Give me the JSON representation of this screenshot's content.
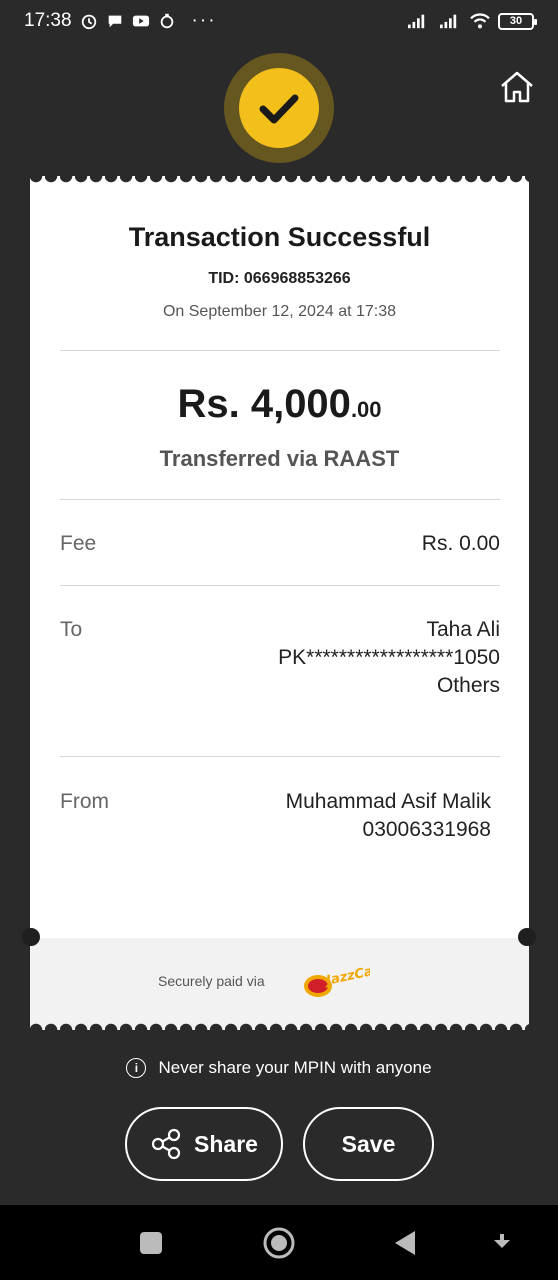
{
  "status_bar": {
    "time": "17:38",
    "more": "···",
    "battery": "30"
  },
  "receipt": {
    "title": "Transaction Successful",
    "tid": "TID: 066968853266",
    "date": "On September 12, 2024 at 17:38",
    "amount_main": "Rs. 4,000",
    "amount_decimal": ".00",
    "via": "Transferred via RAAST",
    "fee_label": "Fee",
    "fee_value": "Rs. 0.00",
    "to_label": "To",
    "to_name": "Taha Ali",
    "to_account": "PK******************1050",
    "to_bank": "Others",
    "from_label": "From",
    "from_name": "Muhammad Asif Malik",
    "from_number": "03006331968",
    "secure_text": "Securely paid via",
    "logo_text": "JazzCash"
  },
  "warning": {
    "text": "Never share your MPIN with anyone"
  },
  "actions": {
    "share_label": "Share",
    "save_label": "Save"
  },
  "colors": {
    "background": "#2a2a2a",
    "accent": "#f3bf1a",
    "receipt": "#ffffff",
    "footer_strip": "#f2f2f2"
  },
  "icons": [
    "alarm-icon",
    "chat-icon",
    "youtube-icon",
    "app-icon",
    "signal-icon",
    "wifi-icon",
    "battery-icon",
    "check-icon",
    "home-icon",
    "info-icon",
    "share-icon",
    "recents-icon",
    "home-nav-icon",
    "back-icon",
    "nav-down-icon"
  ]
}
